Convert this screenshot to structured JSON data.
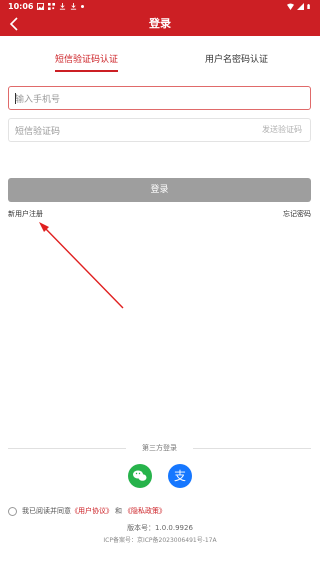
{
  "statusbar": {
    "time": "10:06"
  },
  "navbar": {
    "title": "登录"
  },
  "tabs": {
    "sms_label": "短信验证码认证",
    "password_label": "用户名密码认证"
  },
  "form": {
    "phone_placeholder": "输入手机号",
    "code_placeholder": "短信验证码",
    "send_code_label": "发送验证码",
    "login_label": "登录"
  },
  "links": {
    "register": "新用户注册",
    "forgot": "忘记密码"
  },
  "third_party": {
    "title": "第三方登录"
  },
  "agreement": {
    "prefix": "我已阅读并同意",
    "user_agreement": "《用户协议》",
    "and": "和",
    "privacy": "《隐私政策》"
  },
  "footer": {
    "version": "版本号：1.0.0.9926",
    "icp": "ICP备案号：京ICP备2023006491号-17A"
  },
  "colors": {
    "brand": "#cc1f24",
    "button_disabled": "#9e9e9e",
    "wechat": "#27b34b",
    "alipay": "#1677ff"
  },
  "icons": [
    "image-icon",
    "qr-icon",
    "download-icon",
    "wifi-icon",
    "signal-icon",
    "battery-icon",
    "back-arrow-icon",
    "wechat-icon",
    "alipay-icon"
  ]
}
